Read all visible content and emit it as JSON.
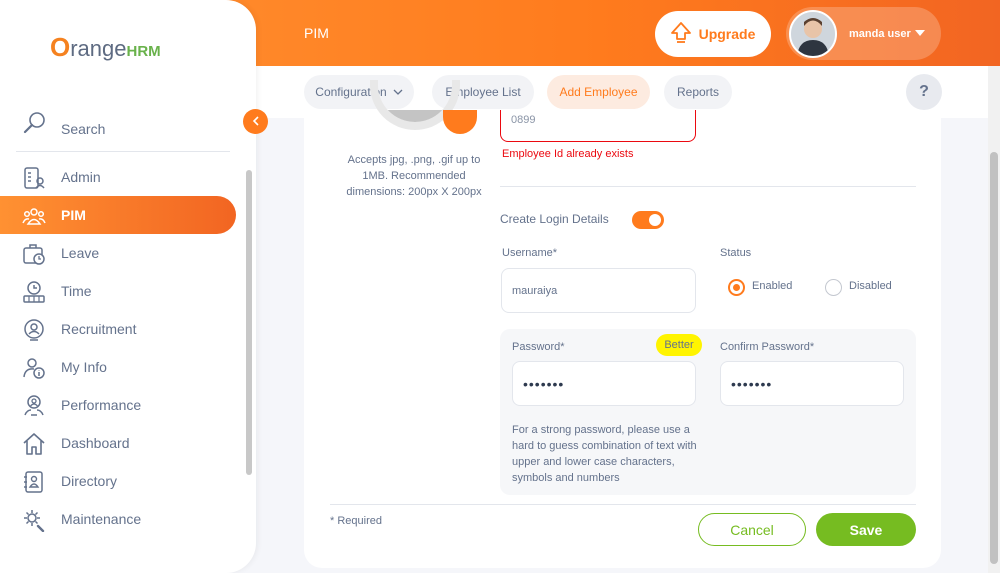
{
  "app": {
    "logo_prefix": "O",
    "logo_main": "range",
    "logo_suffix": "HRM"
  },
  "header": {
    "module_title": "PIM",
    "upgrade_label": "Upgrade",
    "user_name": "manda user"
  },
  "subnav": {
    "tabs": [
      {
        "label": "Configuration",
        "has_dropdown": true
      },
      {
        "label": "Employee List"
      },
      {
        "label": "Add Employee",
        "active": true
      },
      {
        "label": "Reports"
      }
    ],
    "help_label": "?"
  },
  "sidebar": {
    "search_label": "Search",
    "items": [
      {
        "label": "Admin",
        "icon": "admin-icon"
      },
      {
        "label": "PIM",
        "icon": "pim-icon",
        "active": true
      },
      {
        "label": "Leave",
        "icon": "leave-icon"
      },
      {
        "label": "Time",
        "icon": "time-icon"
      },
      {
        "label": "Recruitment",
        "icon": "recruitment-icon"
      },
      {
        "label": "My Info",
        "icon": "my-info-icon"
      },
      {
        "label": "Performance",
        "icon": "performance-icon"
      },
      {
        "label": "Dashboard",
        "icon": "dashboard-icon"
      },
      {
        "label": "Directory",
        "icon": "directory-icon"
      },
      {
        "label": "Maintenance",
        "icon": "maintenance-icon"
      }
    ]
  },
  "form": {
    "photo_hint": "Accepts jpg, .png, .gif up to 1MB. Recommended dimensions: 200px X 200px",
    "employee_id_value": "0899",
    "employee_id_error": "Employee Id already exists",
    "create_login_label": "Create Login Details",
    "create_login_enabled": true,
    "username_label": "Username*",
    "username_value": "mauraiya",
    "status_label": "Status",
    "status_options": [
      "Enabled",
      "Disabled"
    ],
    "status_selected": "Enabled",
    "password_label": "Password*",
    "password_strength": "Better",
    "password_value": "•••••••",
    "confirm_password_label": "Confirm Password*",
    "confirm_password_value": "•••••••",
    "password_help": "For a strong password, please use a hard to guess combination of text with upper and lower case characters, symbols and numbers",
    "required_note": "* Required",
    "cancel_label": "Cancel",
    "save_label": "Save"
  },
  "colors": {
    "accent": "#ff7b1d",
    "success": "#76bc21",
    "error": "#eb0910",
    "strength": "#fff400"
  }
}
